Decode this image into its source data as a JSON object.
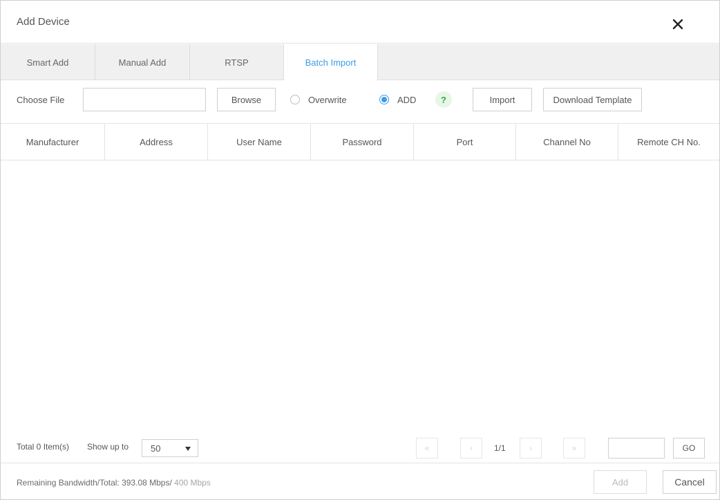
{
  "dialog": {
    "title": "Add Device",
    "tabs": [
      "Smart Add",
      "Manual Add",
      "RTSP",
      "Batch Import"
    ],
    "active_tab": "Batch Import"
  },
  "toolbar": {
    "choose_file_label": "Choose File",
    "file_value": "",
    "browse_label": "Browse",
    "overwrite_label": "Overwrite",
    "add_label": "ADD",
    "selected_mode": "ADD",
    "help_glyph": "?",
    "import_label": "Import",
    "download_template_label": "Download Template"
  },
  "table": {
    "columns": [
      "Manufacturer",
      "Address",
      "User Name",
      "Password",
      "Port",
      "Channel No",
      "Remote CH No."
    ],
    "rows": []
  },
  "pagination": {
    "total_label": "Total 0 Item(s)",
    "show_up_to_label": "Show up to",
    "page_size": "50",
    "page_indicator": "1/1",
    "goto_value": "",
    "go_label": "GO"
  },
  "status": {
    "bandwidth_label": "Remaining Bandwidth/Total: 393.08 Mbps/",
    "bandwidth_total": "400 Mbps"
  },
  "actions": {
    "add_label": "Add",
    "cancel_label": "Cancel"
  },
  "colors": {
    "accent": "#3d9be9",
    "help_green": "#2eaa4a",
    "tab_bar_bg": "#f0f0f0"
  },
  "icons": {
    "close": "close-icon",
    "help": "help-icon",
    "first_page": "double-chevron-left-icon",
    "prev_page": "chevron-left-icon",
    "next_page": "chevron-right-icon",
    "last_page": "double-chevron-right-icon",
    "dropdown": "caret-down-icon"
  }
}
